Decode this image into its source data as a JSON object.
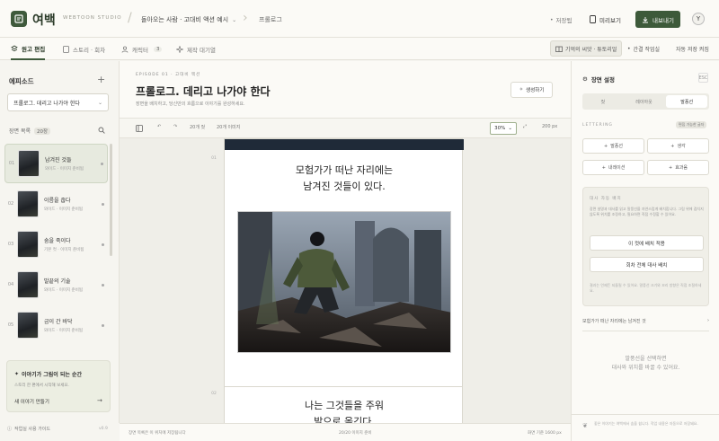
{
  "header": {
    "brand": "여백",
    "brand_sub": "WEBTOON STUDIO",
    "project": "돌아오는 사람 · 고대비 액션 예시",
    "crumb": "프롤로그",
    "saved": "저장됨",
    "preview": "미리보기",
    "export": "내보내기",
    "avatar": "Y"
  },
  "tabs": [
    {
      "label": "원고 편집"
    },
    {
      "label": "스토리 · 회차"
    },
    {
      "label": "캐릭터",
      "count": "3"
    },
    {
      "label": "제작 대기열"
    }
  ],
  "subbar_right": {
    "ref": "기억의 씨앗 · 튜토리얼",
    "spacing": "간결 작업실",
    "guide": "자동 저장 켜짐"
  },
  "sidebar": {
    "title": "에피소드",
    "episode_select": "프롤로그. 데리고 나가야 한다",
    "scene_header": "장면 목록",
    "scene_count": "20장",
    "scenes": [
      {
        "num": "01",
        "title": "남겨진 것들",
        "meta": "와이드 · 이미지 준비됨"
      },
      {
        "num": "02",
        "title": "이름을 줍다",
        "meta": "와이드 · 이미지 준비됨"
      },
      {
        "num": "03",
        "title": "숨을 죽이다",
        "meta": "기본 컷 · 이미지 준비됨"
      },
      {
        "num": "04",
        "title": "발끝의 기술",
        "meta": "와이드 · 이미지 준비됨"
      },
      {
        "num": "05",
        "title": "금이 간 바닥",
        "meta": "와이드 · 이미지 준비됨"
      }
    ],
    "promo": {
      "title": "이야기가 그림이 되는 순간",
      "desc": "스토리 한 편에서 시작해 보세요.",
      "link": "새 이야기 만들기"
    },
    "footer": "작업실 사용 가이드",
    "version": "v0.9"
  },
  "episode": {
    "kicker": "EPISODE 01 · 고대비 액션",
    "title": "프롤로그. 데리고 나가야 한다",
    "desc": "장면을 배치하고, 당신만의 흐름으로 이야기를 완성하세요.",
    "generate": "생성하기"
  },
  "toolbar": {
    "scenes": "20개 컷",
    "images": "20개 이미지",
    "zoom": "30%",
    "width": "200 px"
  },
  "canvas": {
    "row1": "01",
    "row2": "02",
    "caption1_line1": "모험가가 떠난 자리에는",
    "caption1_line2": "남겨진 것들이 있다.",
    "caption2_line1": "나는 그것들을 주워",
    "caption2_line2": "발으로 옮긴다."
  },
  "status": {
    "left": "장면 목록은 이 위치에 저장됩니다",
    "center": "20/20 이미지 준비",
    "right": "화면 기준 1600 px"
  },
  "right_panel": {
    "title": "장면 설정",
    "close": "ESC",
    "segments": [
      "컷",
      "레이아웃",
      "말풍선"
    ],
    "lettering_label": "LETTERING",
    "lettering_tag": "편집 가능한 글자",
    "add_buttons": [
      "말풍선",
      "생각",
      "내레이션",
      "효과음"
    ],
    "auto": {
      "title": "대사 자동 배치",
      "desc": "장면 설명과 대사를 읽고 말풍선을 자연스럽게 배치합니다. 그림 위에 겹치지 않도록 위치를 조정하고, 필요하면 직접 수정할 수 있어요.",
      "btn1": "이 컷에 배치 적용",
      "btn2": "회차 전체 대사 배치",
      "note": "결과는 언제든 되돌릴 수 있어요. 말풍선 크기와 꼬리 방향은 직접 조절하세요."
    },
    "bubble_row": "모험가가 떠난 자리에는 남겨진 것",
    "empty_line1": "말풍선을 선택하면",
    "empty_line2": "대사와 위치를 바꿀 수 있어요.",
    "footer": "좋은 이야기는 여백에서 숨을 쉽니다. 작업 내용은 자동으로 저장돼요."
  }
}
